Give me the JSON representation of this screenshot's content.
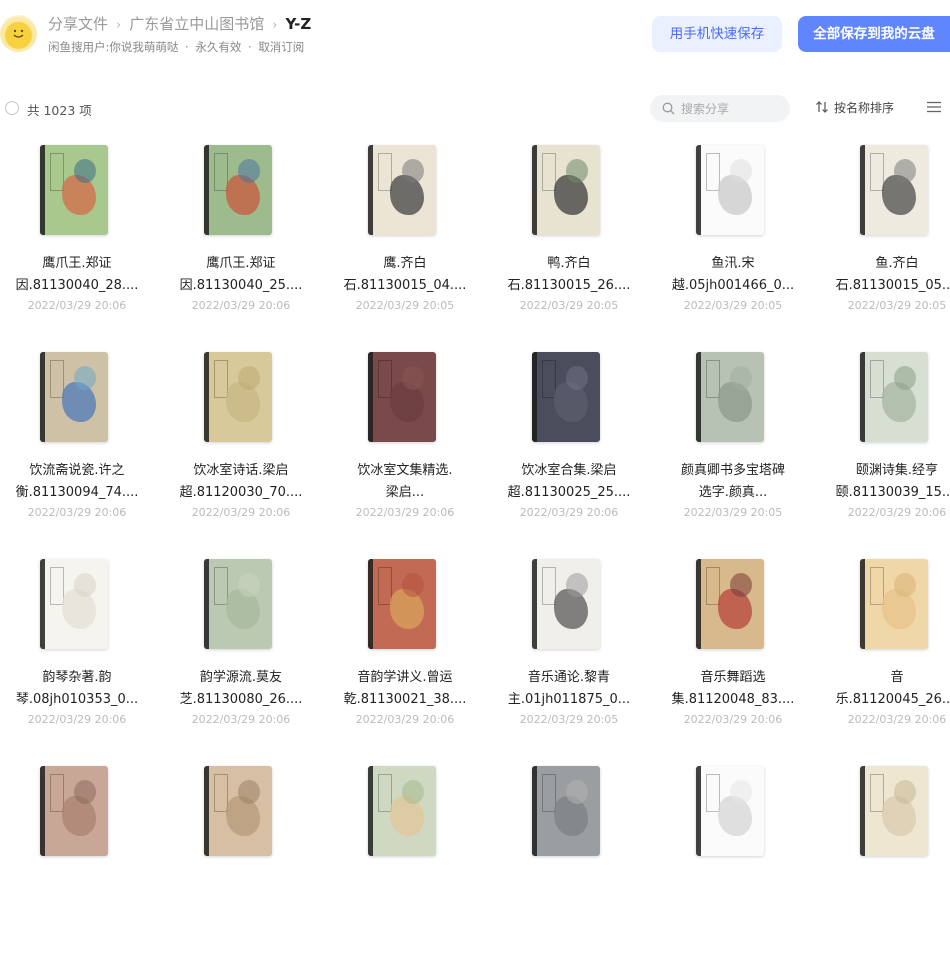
{
  "header": {
    "breadcrumbs": [
      "分享文件",
      "广东省立中山图书馆",
      "Y-Z"
    ],
    "sub_user": "闲鱼搜用户:你说我萌萌哒",
    "sub_validity": "永久有效",
    "sub_unsubscribe": "取消订阅",
    "sub_dot": "·",
    "phone_save_label": "用手机快速保存",
    "save_all_label": "全部保存到我的云盘"
  },
  "toolbar": {
    "count_label": "共 1023 项",
    "search_placeholder": "搜索分享",
    "sort_label": "按名称排序"
  },
  "colors": {
    "accent": "#5f86ff",
    "accent_light": "#eaf0ff",
    "date_text": "#bbbbbb"
  },
  "files": [
    {
      "line1": "鹰爪王.郑证",
      "line2": "因.81130040_28....",
      "date": "2022/03/29 20:06",
      "cover": "#a9c88d",
      "deco": "#d46c4b",
      "deco2": "#3a6d87"
    },
    {
      "line1": "鹰爪王.郑证",
      "line2": "因.81130040_25....",
      "date": "2022/03/29 20:06",
      "cover": "#9dbb8c",
      "deco": "#c95a3e",
      "deco2": "#4a74a0"
    },
    {
      "line1": "鹰.齐白",
      "line2": "石.81130015_04....",
      "date": "2022/03/29 20:05",
      "cover": "#ece4d4",
      "deco": "#444444",
      "deco2": "#7a7a7a"
    },
    {
      "line1": "鸭.齐白",
      "line2": "石.81130015_26....",
      "date": "2022/03/29 20:05",
      "cover": "#e8e3d0",
      "deco": "#3c3c3c",
      "deco2": "#6e8a6a"
    },
    {
      "line1": "鱼汛.宋",
      "line2": "越.05jh001466_0...",
      "date": "2022/03/29 20:05",
      "cover": "#fbfbfb",
      "deco": "#c9c9c9",
      "deco2": "#e0e0e0"
    },
    {
      "line1": "鱼.齐白",
      "line2": "石.81130015_05....",
      "date": "2022/03/29 20:05",
      "cover": "#eeeae0",
      "deco": "#4d4d4d",
      "deco2": "#7b7b7b"
    },
    {
      "line1": "饮流斋说瓷.许之",
      "line2": "衡.81130094_74....",
      "date": "2022/03/29 20:06",
      "cover": "#cfc1a6",
      "deco": "#4f7ab8",
      "deco2": "#6fa8c8"
    },
    {
      "line1": "饮冰室诗话.梁启",
      "line2": "超.81120030_70....",
      "date": "2022/03/29 20:06",
      "cover": "#d8c99a",
      "deco": "#c7b784",
      "deco2": "#bda973"
    },
    {
      "line1": "饮冰室文集精选.",
      "line2": "梁启...",
      "date": "2022/03/29 20:06",
      "cover": "#7a4a4a",
      "deco": "#6b3d3d",
      "deco2": "#8a5555"
    },
    {
      "line1": "饮冰室合集.梁启",
      "line2": "超.81130025_25....",
      "date": "2022/03/29 20:06",
      "cover": "#4b4d5c",
      "deco": "#5b5e6e",
      "deco2": "#707384"
    },
    {
      "line1": "颜真卿书多宝塔碑",
      "line2": "选字.颜真...",
      "date": "2022/03/29 20:05",
      "cover": "#b7c1b4",
      "deco": "#8c9a8c",
      "deco2": "#a3ae9f"
    },
    {
      "line1": "颐渊诗集.经亨",
      "line2": "颐.81130039_15....",
      "date": "2022/03/29 20:06",
      "cover": "#d7dfd2",
      "deco": "#a6b5a0",
      "deco2": "#8a9c86"
    },
    {
      "line1": "韵琴杂著.韵",
      "line2": "琴.08jh010353_0...",
      "date": "2022/03/29 20:06",
      "cover": "#f6f4ef",
      "deco": "#e4e0d6",
      "deco2": "#d8d3c6"
    },
    {
      "line1": "韵学源流.莫友",
      "line2": "芝.81130080_26....",
      "date": "2022/03/29 20:06",
      "cover": "#bcc9b2",
      "deco": "#a8b89d",
      "deco2": "#c9d3c0"
    },
    {
      "line1": "音韵学讲义.曾运",
      "line2": "乾.81130021_38....",
      "date": "2022/03/29 20:06",
      "cover": "#c36a55",
      "deco": "#d8a35b",
      "deco2": "#b4503e"
    },
    {
      "line1": "音乐通论.黎青",
      "line2": "主.01jh011875_0...",
      "date": "2022/03/29 20:05",
      "cover": "#f1efea",
      "deco": "#5a5a5a",
      "deco2": "#9a9a9a"
    },
    {
      "line1": "音乐舞蹈选",
      "line2": "集.81120048_83....",
      "date": "2022/03/29 20:06",
      "cover": "#d8b98b",
      "deco": "#b7453b",
      "deco2": "#7a3a3a"
    },
    {
      "line1": "音",
      "line2": "乐.81120045_26....",
      "date": "2022/03/29 20:06",
      "cover": "#f0d7a8",
      "deco": "#e7c48a",
      "deco2": "#d9b272"
    },
    {
      "line1": "",
      "line2": "",
      "date": "",
      "cover": "#c9a797",
      "deco": "#a98270",
      "deco2": "#8c6c5d"
    },
    {
      "line1": "",
      "line2": "",
      "date": "",
      "cover": "#d6bfa2",
      "deco": "#b59a7a",
      "deco2": "#9c8166"
    },
    {
      "line1": "",
      "line2": "",
      "date": "",
      "cover": "#cfd9c2",
      "deco": "#e1c69a",
      "deco2": "#a7b98d"
    },
    {
      "line1": "",
      "line2": "",
      "date": "",
      "cover": "#9b9ea0",
      "deco": "#7d8083",
      "deco2": "#b1b3b5"
    },
    {
      "line1": "",
      "line2": "",
      "date": "",
      "cover": "#fbfbfb",
      "deco": "#d6d6d6",
      "deco2": "#e5e5e5"
    },
    {
      "line1": "",
      "line2": "",
      "date": "",
      "cover": "#efe6d2",
      "deco": "#d9cbae",
      "deco2": "#c7b893"
    }
  ]
}
